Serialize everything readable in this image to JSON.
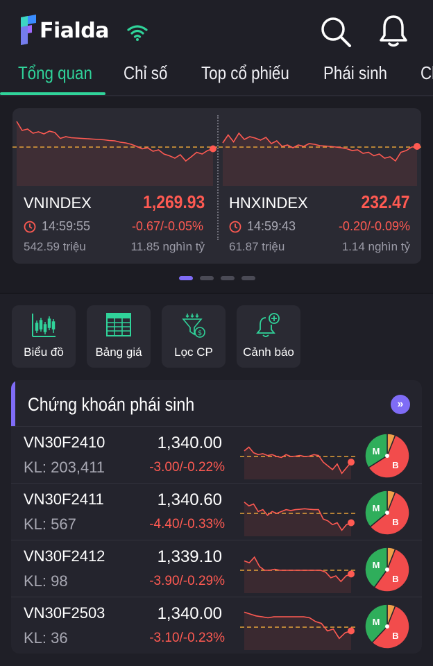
{
  "app": {
    "name": "Fialda"
  },
  "tabs": [
    {
      "label": "Tổng quan",
      "active": true
    },
    {
      "label": "Chỉ số",
      "active": false
    },
    {
      "label": "Top cổ phiếu",
      "active": false
    },
    {
      "label": "Phái sinh",
      "active": false
    },
    {
      "label": "Cl",
      "active": false
    }
  ],
  "indices": [
    {
      "name": "VNINDEX",
      "value": "1,269.93",
      "time": "14:59:55",
      "change": "-0.67/-0.05%",
      "volume": "542.59 triệu",
      "turnover": "11.85 nghìn tỷ",
      "spark": [
        0.74,
        0.48,
        0.52,
        0.4,
        0.44,
        0.38,
        0.46,
        0.42,
        0.25,
        0.3,
        0.27,
        0.26,
        0.25,
        0.24,
        0.23,
        0.22,
        0.21,
        0.19,
        0.18,
        0.14,
        0.12,
        0.08,
        0.02,
        -0.05,
        -0.02,
        -0.12,
        -0.08,
        -0.2,
        -0.25,
        -0.32,
        -0.22,
        -0.4,
        -0.28,
        -0.15,
        -0.2,
        -0.1,
        -0.05
      ]
    },
    {
      "name": "HNXINDEX",
      "value": "232.47",
      "time": "14:59:43",
      "change": "-0.20/-0.09%",
      "volume": "61.87 triệu",
      "turnover": "1.14 nghìn tỷ",
      "spark": [
        0.12,
        0.35,
        0.15,
        0.4,
        0.22,
        0.3,
        0.26,
        0.2,
        0.28,
        0.1,
        0.18,
        0.02,
        0.06,
        -0.02,
        0.06,
        0.02,
        0.1,
        0.08,
        0.04,
        0.03,
        0.02,
        0.0,
        -0.02,
        -0.05,
        -0.1,
        -0.08,
        -0.18,
        -0.15,
        -0.25,
        -0.2,
        -0.32,
        -0.28,
        -0.4,
        -0.15,
        -0.1,
        0.0,
        0.02
      ]
    }
  ],
  "carousel": {
    "pages": 4,
    "active": 0
  },
  "quick_actions": [
    {
      "label": "Biểu đồ",
      "icon": "candlestick-chart-icon"
    },
    {
      "label": "Bảng giá",
      "icon": "price-table-icon"
    },
    {
      "label": "Lọc CP",
      "icon": "stock-filter-icon"
    },
    {
      "label": "Cảnh báo",
      "icon": "alert-bell-icon"
    }
  ],
  "derivatives": {
    "title": "Chứng khoán phái sinh",
    "more_label": "»",
    "rows": [
      {
        "symbol": "VN30F2410",
        "kl": "KL: 203,411",
        "price": "1,340.00",
        "change": "-3.00/-0.22%",
        "spark": [
          0.3,
          0.5,
          0.2,
          0.1,
          0.15,
          0.05,
          0.1,
          0.0,
          -0.05,
          0.1,
          0.0,
          0.02,
          0.05,
          0.0,
          0.02,
          0.1,
          0.05,
          -0.3,
          -0.5,
          -0.7,
          -0.4,
          -0.9,
          -0.6,
          -0.3
        ],
        "pie": {
          "buy_m": 0.34,
          "sell_b": 0.6,
          "other": 0.06
        }
      },
      {
        "symbol": "VN30F2411",
        "kl": "KL: 567",
        "price": "1,340.60",
        "change": "-4.40/-0.33%",
        "spark": [
          0.6,
          0.4,
          0.5,
          0.1,
          0.2,
          -0.1,
          0.1,
          0.0,
          0.1,
          0.2,
          0.15,
          0.2,
          0.22,
          0.25,
          0.22,
          0.2,
          0.2,
          -0.3,
          -0.4,
          -0.6,
          -0.5,
          -0.9,
          -0.6,
          -0.5
        ],
        "pie": {
          "buy_m": 0.36,
          "sell_b": 0.58,
          "other": 0.06
        }
      },
      {
        "symbol": "VN30F2412",
        "kl": "KL: 98",
        "price": "1,339.10",
        "change": "-3.90/-0.29%",
        "spark": [
          0.5,
          0.4,
          0.7,
          0.2,
          0.0,
          0.0,
          0.05,
          0.0,
          0.0,
          0.0,
          0.0,
          0.0,
          0.0,
          0.0,
          0.0,
          0.0,
          -0.1,
          -0.4,
          -0.3,
          -0.6,
          -0.3,
          -0.2
        ],
        "pie": {
          "buy_m": 0.4,
          "sell_b": 0.54,
          "other": 0.06
        }
      },
      {
        "symbol": "VN30F2503",
        "kl": "KL: 36",
        "price": "1,340.00",
        "change": "-3.10/-0.23%",
        "spark": [
          0.8,
          0.7,
          0.6,
          0.55,
          0.5,
          0.55,
          0.55,
          0.55,
          0.55,
          0.55,
          0.55,
          0.5,
          0.3,
          0.2,
          -0.2,
          -0.1,
          -0.6,
          -0.3,
          -0.2
        ],
        "pie": {
          "buy_m": 0.38,
          "sell_b": 0.56,
          "other": 0.06
        }
      }
    ]
  },
  "colors": {
    "accent": "#30d39a",
    "purple": "#7f6cf6",
    "down": "#ff5a52",
    "ref": "#e5a23a",
    "buy": "#2fae5b",
    "sell": "#f24c4c",
    "other": "#f0a04a"
  }
}
